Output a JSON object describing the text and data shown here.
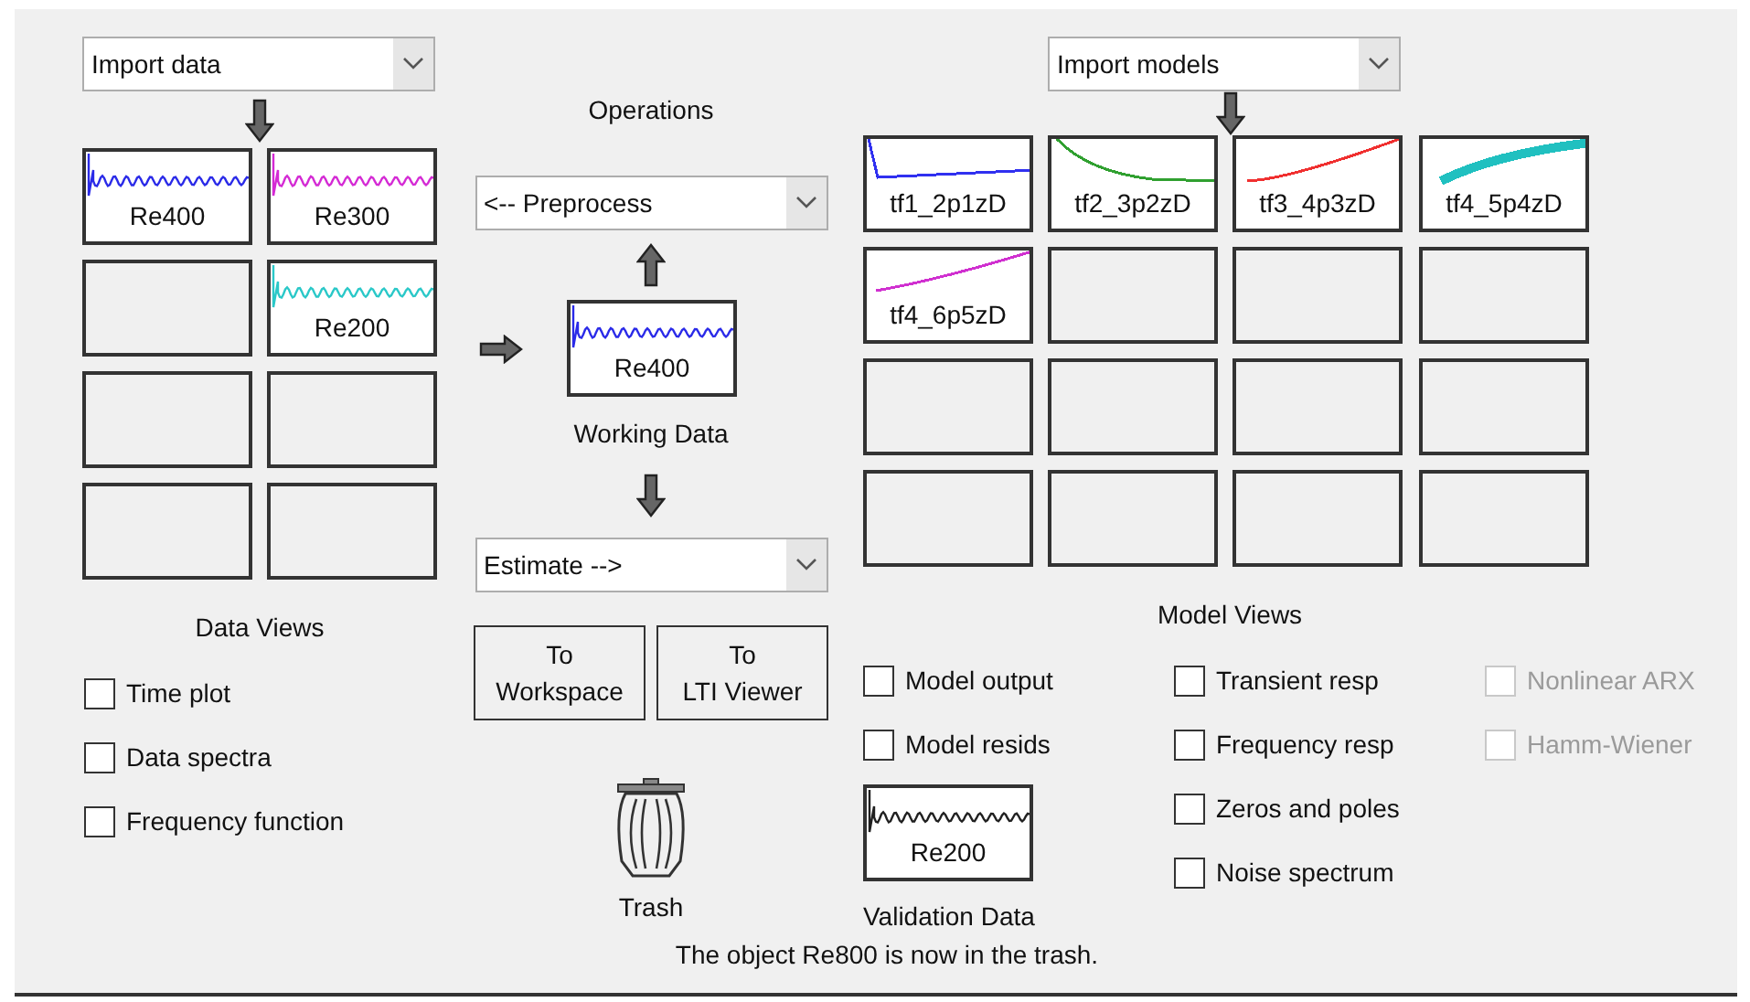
{
  "data_panel": {
    "import_dropdown": "Import data",
    "slots": [
      {
        "kind": "signal",
        "name": "Re400",
        "color": "#2a2ae8"
      },
      {
        "kind": "signal",
        "name": "Re300",
        "color": "#d42ad4"
      },
      {
        "kind": "empty"
      },
      {
        "kind": "signal",
        "name": "Re200",
        "color": "#2ac8c8"
      },
      {
        "kind": "empty"
      },
      {
        "kind": "empty"
      },
      {
        "kind": "empty"
      },
      {
        "kind": "empty"
      }
    ],
    "views_title": "Data Views",
    "views": [
      {
        "label": "Time plot",
        "checked": false,
        "disabled": false
      },
      {
        "label": "Data spectra",
        "checked": false,
        "disabled": false
      },
      {
        "label": "Frequency function",
        "checked": false,
        "disabled": false
      }
    ]
  },
  "operations": {
    "title": "Operations",
    "preprocess_dropdown": "<-- Preprocess",
    "working_data": {
      "name": "Re400",
      "color": "#2a2ae8",
      "label": "Working Data"
    },
    "estimate_dropdown": "Estimate -->",
    "buttons": [
      {
        "line1": "To",
        "line2": "Workspace"
      },
      {
        "line1": "To",
        "line2": "LTI Viewer"
      }
    ],
    "trash_label": "Trash"
  },
  "model_panel": {
    "import_dropdown": "Import models",
    "slots": [
      {
        "kind": "model",
        "name": "tf1_2p1zD",
        "color": "#3030f0"
      },
      {
        "kind": "model",
        "name": "tf2_3p2zD",
        "color": "#30a030"
      },
      {
        "kind": "model",
        "name": "tf3_4p3zD",
        "color": "#f03030"
      },
      {
        "kind": "model",
        "name": "tf4_5p4zD",
        "color": "#20c0c0"
      },
      {
        "kind": "model",
        "name": "tf4_6p5zD",
        "color": "#d030d0"
      },
      {
        "kind": "empty"
      },
      {
        "kind": "empty"
      },
      {
        "kind": "empty"
      },
      {
        "kind": "empty"
      },
      {
        "kind": "empty"
      },
      {
        "kind": "empty"
      },
      {
        "kind": "empty"
      },
      {
        "kind": "empty"
      },
      {
        "kind": "empty"
      },
      {
        "kind": "empty"
      },
      {
        "kind": "empty"
      }
    ],
    "views_title": "Model Views",
    "views_col1": [
      {
        "label": "Model output",
        "checked": false,
        "disabled": false
      },
      {
        "label": "Model resids",
        "checked": false,
        "disabled": false
      }
    ],
    "validation_data": {
      "name": "Re200",
      "color": "#202020",
      "label": "Validation Data"
    },
    "views_col2": [
      {
        "label": "Transient resp",
        "checked": false,
        "disabled": false
      },
      {
        "label": "Frequency resp",
        "checked": false,
        "disabled": false
      },
      {
        "label": "Zeros and poles",
        "checked": false,
        "disabled": false
      },
      {
        "label": "Noise spectrum",
        "checked": false,
        "disabled": false
      }
    ],
    "views_col3": [
      {
        "label": "Nonlinear ARX",
        "checked": false,
        "disabled": true
      },
      {
        "label": "Hamm-Wiener",
        "checked": false,
        "disabled": true
      }
    ]
  },
  "status_bar": "The object Re800 is now in the trash."
}
